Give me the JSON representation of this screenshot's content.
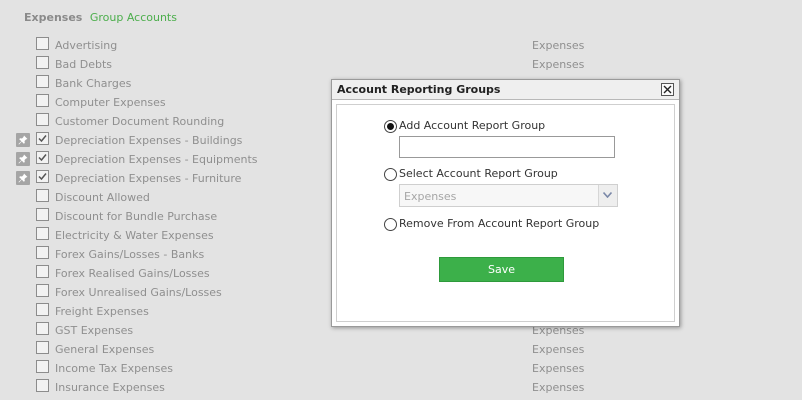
{
  "breadcrumb": {
    "main": "Expenses",
    "sub": "Group Accounts"
  },
  "accounts": [
    {
      "name": "Advertising",
      "checked": false,
      "pinned": false,
      "group": "Expenses"
    },
    {
      "name": "Bad Debts",
      "checked": false,
      "pinned": false,
      "group": "Expenses"
    },
    {
      "name": "Bank Charges",
      "checked": false,
      "pinned": false,
      "group": ""
    },
    {
      "name": "Computer Expenses",
      "checked": false,
      "pinned": false,
      "group": ""
    },
    {
      "name": "Customer Document Rounding",
      "checked": false,
      "pinned": false,
      "group": ""
    },
    {
      "name": "Depreciation Expenses - Buildings",
      "checked": true,
      "pinned": true,
      "group": ""
    },
    {
      "name": "Depreciation Expenses - Equipments",
      "checked": true,
      "pinned": true,
      "group": ""
    },
    {
      "name": "Depreciation Expenses - Furniture",
      "checked": true,
      "pinned": true,
      "group": ""
    },
    {
      "name": "Discount Allowed",
      "checked": false,
      "pinned": false,
      "group": ""
    },
    {
      "name": "Discount for Bundle Purchase",
      "checked": false,
      "pinned": false,
      "group": ""
    },
    {
      "name": "Electricity & Water Expenses",
      "checked": false,
      "pinned": false,
      "group": ""
    },
    {
      "name": "Forex Gains/Losses - Banks",
      "checked": false,
      "pinned": false,
      "group": ""
    },
    {
      "name": "Forex Realised Gains/Losses",
      "checked": false,
      "pinned": false,
      "group": ""
    },
    {
      "name": "Forex Unrealised Gains/Losses",
      "checked": false,
      "pinned": false,
      "group": ""
    },
    {
      "name": "Freight Expenses",
      "checked": false,
      "pinned": false,
      "group": ""
    },
    {
      "name": "GST Expenses",
      "checked": false,
      "pinned": false,
      "group": "Expenses"
    },
    {
      "name": "General Expenses",
      "checked": false,
      "pinned": false,
      "group": "Expenses"
    },
    {
      "name": "Income Tax Expenses",
      "checked": false,
      "pinned": false,
      "group": "Expenses"
    },
    {
      "name": "Insurance Expenses",
      "checked": false,
      "pinned": false,
      "group": "Expenses"
    }
  ],
  "dialog": {
    "title": "Account Reporting Groups",
    "options": {
      "add": "Add Account Report Group",
      "select": "Select Account Report Group",
      "remove": "Remove From Account Report Group"
    },
    "selected_option": "add",
    "add_input_value": "",
    "select_value": "Expenses",
    "save_label": "Save"
  },
  "colors": {
    "accent_green": "#3cb04a",
    "breadcrumb_green": "#4cae4c",
    "background": "#e3e3e3"
  },
  "icons": {
    "pin": "pin-icon",
    "close": "close-icon",
    "dropdown": "chevron-down-icon",
    "check": "checkmark-icon"
  }
}
